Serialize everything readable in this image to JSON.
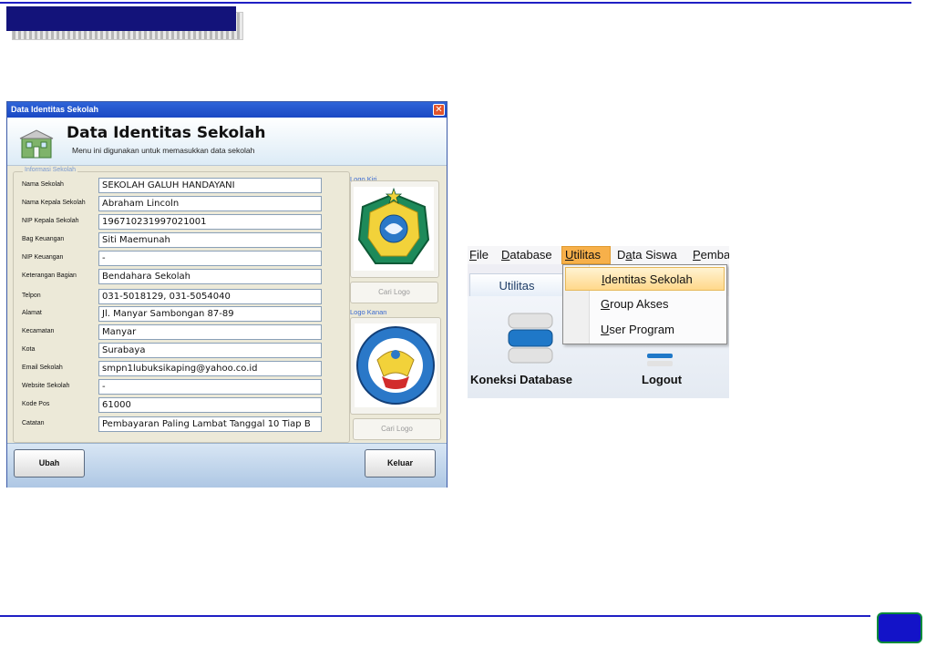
{
  "window": {
    "title": "Data Identitas Sekolah",
    "close_glyph": "✕",
    "header_title": "Data Identitas Sekolah",
    "header_subtitle": "Menu ini digunakan untuk memasukkan data sekolah"
  },
  "group_label": "Informasi Sekolah",
  "fields": [
    {
      "label": "Nama Sekolah",
      "value": "SEKOLAH GALUH HANDAYANI"
    },
    {
      "label": "Nama Kepala Sekolah",
      "value": "Abraham Lincoln"
    },
    {
      "label": "NIP Kepala Sekolah",
      "value": "196710231997021001"
    },
    {
      "label": "Bag Keuangan",
      "value": "Siti Maemunah"
    },
    {
      "label": "NIP Keuangan",
      "value": "-"
    },
    {
      "label": "Keterangan Bagian",
      "value": "Bendahara Sekolah"
    },
    {
      "label": "Telpon",
      "value": "031-5018129, 031-5054040"
    },
    {
      "label": "Alamat",
      "value": "Jl. Manyar Sambongan 87-89"
    },
    {
      "label": "Kecamatan",
      "value": "Manyar"
    },
    {
      "label": "Kota",
      "value": "Surabaya"
    },
    {
      "label": "Email Sekolah",
      "value": "smpn1lubuksikaping@yahoo.co.id"
    },
    {
      "label": "Website Sekolah",
      "value": "-"
    },
    {
      "label": "Kode Pos",
      "value": "61000"
    },
    {
      "label": "Catatan",
      "value": "Pembayaran Paling Lambat Tanggal 10 Tiap B"
    }
  ],
  "logo_left": {
    "label": "Logo Kiri",
    "button": "Cari Logo"
  },
  "logo_right": {
    "label": "Logo Kanan",
    "button": "Cari Logo"
  },
  "buttons": {
    "edit": "Ubah",
    "exit": "Keluar"
  },
  "menu": {
    "bar": {
      "file": {
        "pre": "",
        "key": "F",
        "post": "ile"
      },
      "database": {
        "pre": "",
        "key": "D",
        "post": "atabase"
      },
      "utilitas": {
        "pre": "",
        "key": "U",
        "post": "tilitas"
      },
      "data_siswa": {
        "pre": "D",
        "key": "a",
        "post": "ta Siswa"
      },
      "pemba": {
        "pre": "",
        "key": "P",
        "post": "emba"
      }
    },
    "ribbon_tab": "Utilitas",
    "ribbon_buttons": {
      "koneksi": "Koneksi Database",
      "logout": "Logout"
    },
    "dropdown": [
      {
        "key": "I",
        "rest": "dentitas Sekolah"
      },
      {
        "key": "G",
        "rest": "roup Akses"
      },
      {
        "key": "U",
        "rest": "ser Program"
      }
    ]
  },
  "colors": {
    "accent_blue": "#1f1fc4",
    "title_navy": "#13137a",
    "menu_active": "#f7b04a"
  }
}
